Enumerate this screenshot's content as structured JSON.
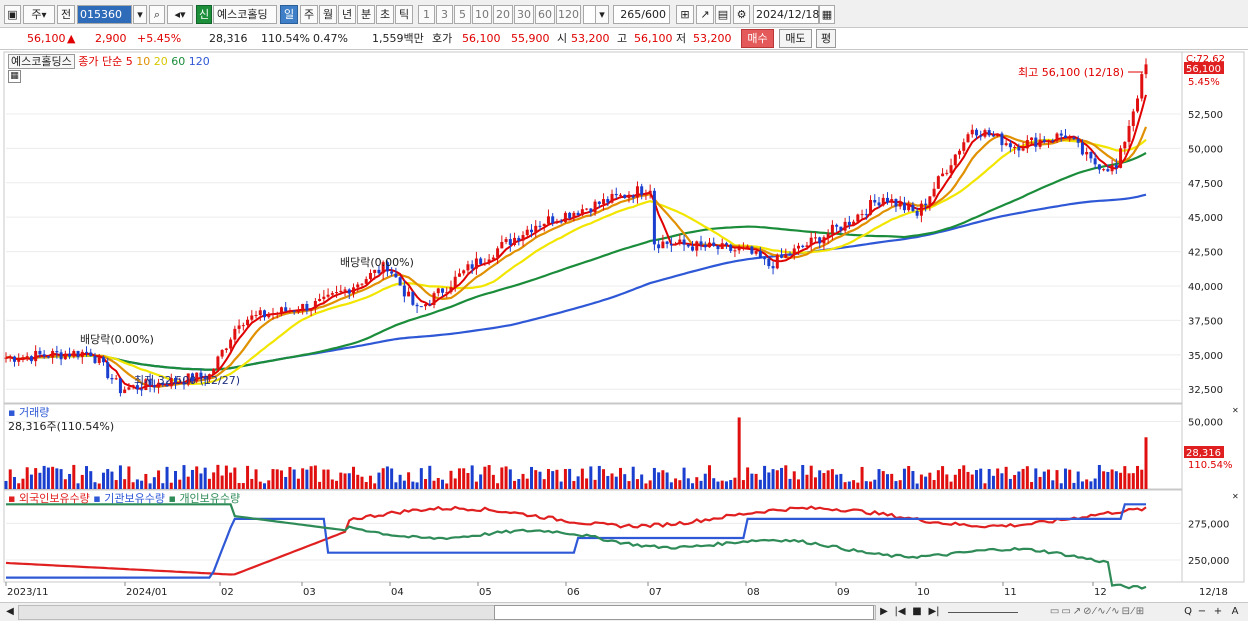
{
  "toolbar": {
    "mode_items": [
      "주",
      "전"
    ],
    "code": "015360",
    "stock_name": "예스코홀딩",
    "badge": "신",
    "periods": [
      "일",
      "주",
      "월",
      "년",
      "분",
      "초",
      "틱"
    ],
    "selected_period": "일",
    "minutes": [
      "1",
      "3",
      "5",
      "10",
      "20",
      "30",
      "60",
      "120"
    ],
    "count": "265",
    "count_total": "/600",
    "date": "2024/12/18"
  },
  "quote": {
    "price": "56,100",
    "arrow": "▲",
    "change": "2,900",
    "change_pct": "+5.45%",
    "volume": "28,316",
    "volume_ratio": "110.54%",
    "turnover": "0.47%",
    "amount": "1,559백만",
    "bid_label": "호가",
    "ask": "56,100",
    "bid": "55,900",
    "open_label": "시",
    "open": "53,200",
    "high_label": "고",
    "high": "56,100",
    "low_label": "저",
    "low": "53,200",
    "buy_label": "매수",
    "sell_label": "매도",
    "eval_label": "평"
  },
  "price_panel": {
    "stock_tag": "예스코홀딩스",
    "legend_prefix": "종가 단순",
    "ma_periods": [
      "5",
      "10",
      "20",
      "60",
      "120"
    ],
    "ma_colors": [
      "#e00000",
      "#e09000",
      "#f2e600",
      "#1a8c3a",
      "#2e58d6"
    ],
    "top_label": "C:72.62",
    "current_label": "56,100",
    "pct_label": "5.45%",
    "high_note": "최고 56,100 (12/18)",
    "low_note": "최저 32,500 (12/27)",
    "dividend_1": "배당락(0.00%)",
    "dividend_2": "배당락(0.00%)",
    "y_ticks": [
      "52,500",
      "50,000",
      "47,500",
      "45,000",
      "42,500",
      "40,000",
      "37,500",
      "35,000",
      "32,500"
    ]
  },
  "volume_panel": {
    "title": "거래량",
    "value": "28,316주(110.54%)",
    "y_ticks": [
      "50,000"
    ],
    "current_label": "28,316",
    "pct_label": "110.54%"
  },
  "holdings_panel": {
    "legend": [
      "외국인보유수량",
      "기관보유수량",
      "개인보유수량"
    ],
    "colors": [
      "#e02020",
      "#2e58d6",
      "#2e8b57"
    ],
    "y_ticks": [
      "275,000",
      "250,000"
    ]
  },
  "x_axis": {
    "labels": [
      "2023/11",
      "2024/01",
      "02",
      "03",
      "04",
      "05",
      "06",
      "07",
      "08",
      "09",
      "10",
      "11",
      "12"
    ],
    "right_label": "12/18"
  },
  "chart_data": {
    "type": "line",
    "title": "예스코홀딩스",
    "ylim": [
      31500,
      57000
    ],
    "key_points": [
      {
        "x": "2023/11",
        "y": 34800
      },
      {
        "x": "2023/12",
        "y": 35200
      },
      {
        "x": "2023/12/27",
        "y": 32500
      },
      {
        "x": "2024/01",
        "y": 33500
      },
      {
        "x": "2024/02",
        "y": 37500
      },
      {
        "x": "2024/03",
        "y": 38800
      },
      {
        "x": "2024/03/27",
        "y": 41500
      },
      {
        "x": "2024/04",
        "y": 38200
      },
      {
        "x": "2024/05",
        "y": 41500
      },
      {
        "x": "2024/05/25",
        "y": 44500
      },
      {
        "x": "2024/06",
        "y": 46000
      },
      {
        "x": "2024/06/28",
        "y": 47200
      },
      {
        "x": "2024/07",
        "y": 43200
      },
      {
        "x": "2024/08",
        "y": 42500
      },
      {
        "x": "2024/08/08",
        "y": 41500
      },
      {
        "x": "2024/09",
        "y": 44500
      },
      {
        "x": "2024/09/20",
        "y": 46500
      },
      {
        "x": "2024/10",
        "y": 45200
      },
      {
        "x": "2024/10/20",
        "y": 51500
      },
      {
        "x": "2024/11",
        "y": 50200
      },
      {
        "x": "2024/11/20",
        "y": 51000
      },
      {
        "x": "2024/12",
        "y": 49000
      },
      {
        "x": "2024/12/10",
        "y": 48500
      },
      {
        "x": "2024/12/18",
        "y": 56100
      }
    ],
    "volume": {
      "current": 28316,
      "ratio_pct": 110.54,
      "peak": 53000
    },
    "holdings": {
      "foreign_range": [
        235000,
        290000
      ],
      "institution_range": [
        235000,
        290000
      ],
      "individual_range": [
        240000,
        290000
      ]
    }
  },
  "statusbar": {
    "buttons": [
      "◀",
      "▶",
      "|◀",
      "■",
      "▶|"
    ],
    "tools": [
      "Q",
      "−",
      "+",
      "A"
    ]
  }
}
